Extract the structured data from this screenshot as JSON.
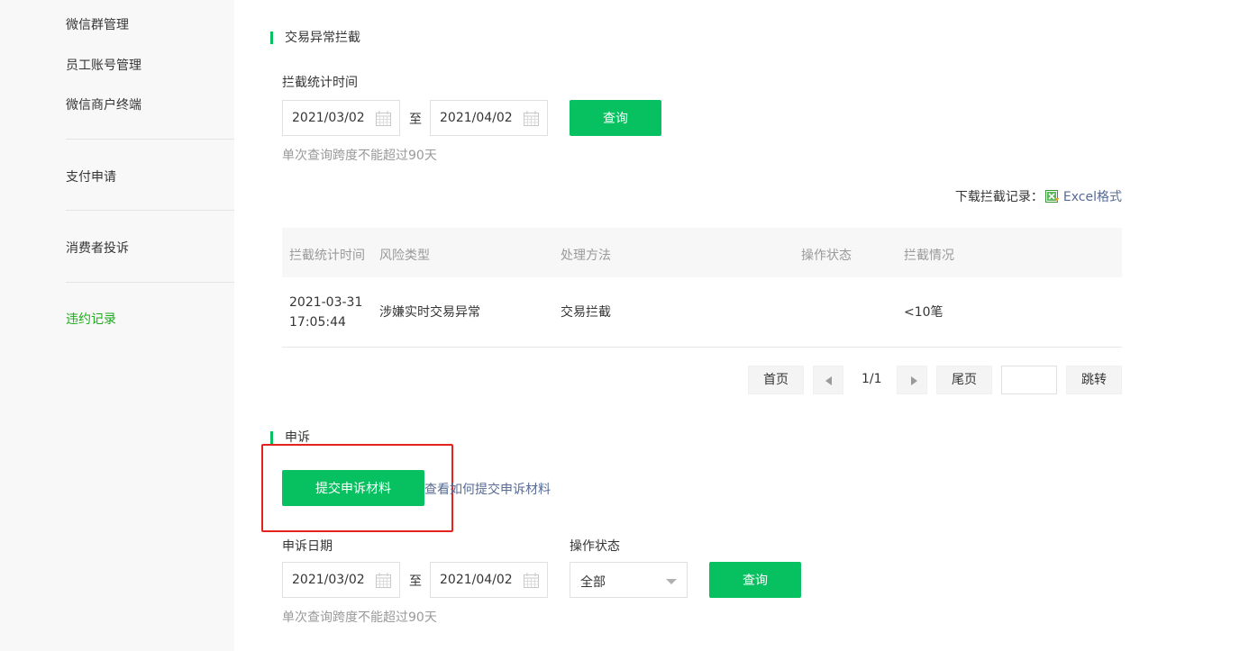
{
  "sidebar": {
    "items": [
      {
        "label": "微信群管理"
      },
      {
        "label": "员工账号管理"
      },
      {
        "label": "微信商户终端"
      },
      {
        "label": "支付申请"
      },
      {
        "label": "消费者投诉"
      },
      {
        "label": "违约记录",
        "active": true
      }
    ]
  },
  "intercept": {
    "title": "交易异常拦截",
    "time_label": "拦截统计时间",
    "start_date": "2021/03/02",
    "to_label": "至",
    "end_date": "2021/04/02",
    "query_label": "查询",
    "hint": "单次查询跨度不能超过90天",
    "download_label": "下载拦截记录：",
    "download_link": "Excel格式",
    "table": {
      "headers": [
        "拦截统计时间",
        "风险类型",
        "处理方法",
        "操作状态",
        "拦截情况"
      ],
      "rows": [
        {
          "time": "2021-03-31 17:05:44",
          "risk": "涉嫌实时交易异常",
          "method": "交易拦截",
          "status": "",
          "result": "<10笔"
        }
      ]
    },
    "pagination": {
      "first": "首页",
      "page_info": "1/1",
      "last": "尾页",
      "jump": "跳转",
      "jump_value": ""
    }
  },
  "appeal": {
    "title": "申诉",
    "submit_label": "提交申诉材料",
    "howto_link": "查看如何提交申诉材料",
    "date_label": "申诉日期",
    "start_date": "2021/03/02",
    "to_label": "至",
    "end_date": "2021/04/02",
    "status_label": "操作状态",
    "status_value": "全部",
    "query_label": "查询",
    "hint": "单次查询跨度不能超过90天"
  },
  "colors": {
    "primary": "#07c160",
    "link": "#576b95",
    "active_nav": "#1aad19",
    "highlight_box": "#e3231c"
  }
}
